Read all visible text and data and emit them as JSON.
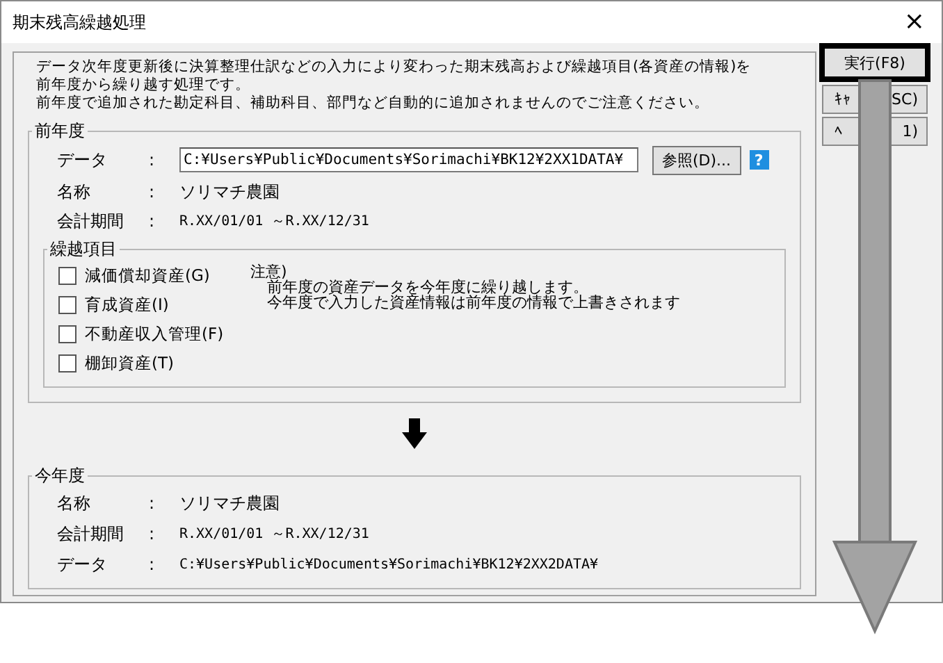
{
  "window": {
    "title": "期末残高繰越処理",
    "close": "×"
  },
  "description": [
    "データ次年度更新後に決算整理仕訳などの入力により変わった期末残高および繰越項目(各資産の情報)を",
    "前年度から繰り越す処理です。",
    "前年度で追加された勘定科目、補助科目、部門など自動的に追加されませんのでご注意ください。"
  ],
  "previous_year": {
    "legend": "前年度",
    "data_row": {
      "label": "データ",
      "separator": ":",
      "value": "C:¥Users¥Public¥Documents¥Sorimachi¥BK12¥2XX1DATA¥"
    },
    "browse_button": "参照(D)...",
    "help": "?",
    "rows": [
      {
        "label": "名称",
        "separator": ":",
        "value": "ソリマチ農園"
      },
      {
        "label": "会計期間",
        "separator": ":",
        "value": "R.XX/01/01 ～R.XX/12/31"
      }
    ],
    "carry_items": {
      "legend": "繰越項目",
      "items": [
        {
          "label": "減価償却資産(G)",
          "checked": false
        },
        {
          "label": "育成資産(I)",
          "checked": false
        },
        {
          "label": "不動産収入管理(F)",
          "checked": false
        },
        {
          "label": "棚卸資産(T)",
          "checked": false
        }
      ],
      "note_title": "注意)",
      "note_lines": [
        "前年度の資産データを今年度に繰り越します。",
        "今年度で入力した資産情報は前年度の情報で上書きされます"
      ]
    }
  },
  "current_year": {
    "legend": "今年度",
    "rows": [
      {
        "label": "名称",
        "separator": ":",
        "value": "ソリマチ農園"
      },
      {
        "label": "会計期間",
        "separator": ":",
        "value": "R.XX/01/01 ～R.XX/12/31"
      },
      {
        "label": "データ",
        "separator": ":",
        "value": "C:¥Users¥Public¥Documents¥Sorimachi¥BK12¥2XX2DATA¥"
      }
    ]
  },
  "buttons": [
    {
      "kind": "full",
      "label": "実行(F8)",
      "highlighted": true
    },
    {
      "kind": "covered",
      "label_left": "ｷｬ",
      "label_right": "SC)",
      "highlighted": false
    },
    {
      "kind": "covered",
      "label_left": "ﾍ",
      "label_right": "1)",
      "highlighted": false
    }
  ]
}
